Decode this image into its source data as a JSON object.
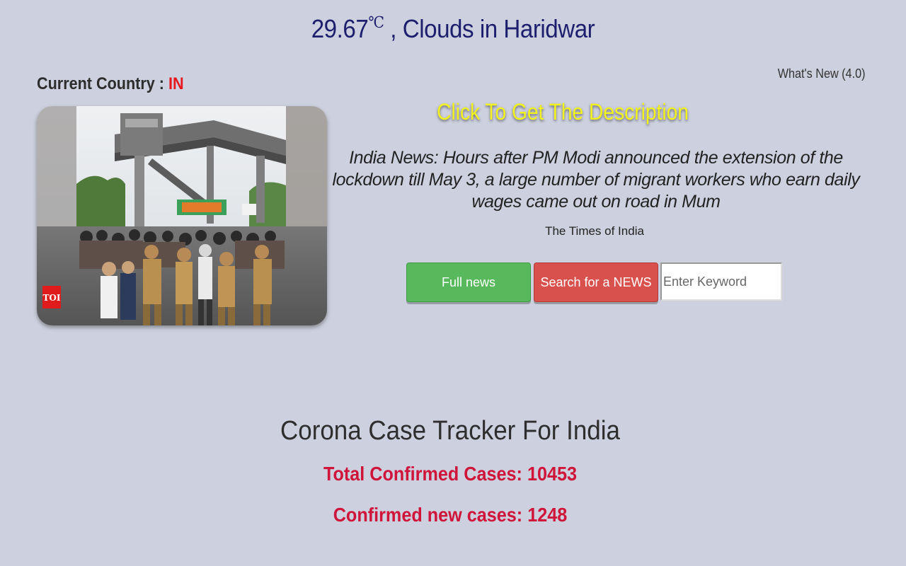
{
  "weather": {
    "temperature": "29.67",
    "unit": "℃",
    "description": ", Clouds in Haridwar"
  },
  "whats_new": "What's New (4.0)",
  "country": {
    "label": "Current Country : ",
    "code": "IN"
  },
  "news": {
    "photo_logo": "TOI",
    "describe_label": "Click To Get The Description",
    "headline": "India News: Hours after PM Modi announced the extension of the lockdown till May 3, a large number of migrant workers who earn daily wages came out on road in Mum",
    "source": "The Times of India",
    "full_news_label": "Full news",
    "search_label": "Search for a NEWS",
    "keyword_placeholder": "Enter Keyword"
  },
  "tracker": {
    "title": "Corona Case Tracker For India",
    "total_confirmed": "Total Confirmed Cases: 10453",
    "new_confirmed": "Confirmed new cases: 1248"
  },
  "colors": {
    "background": "#cdd0de",
    "weather_text": "#1d1f6e",
    "country_code": "#e8171c",
    "describe_yellow": "#f2f21e",
    "green_button": "#57b95b",
    "red_button": "#d8514c",
    "stat_red": "#d0153a"
  }
}
